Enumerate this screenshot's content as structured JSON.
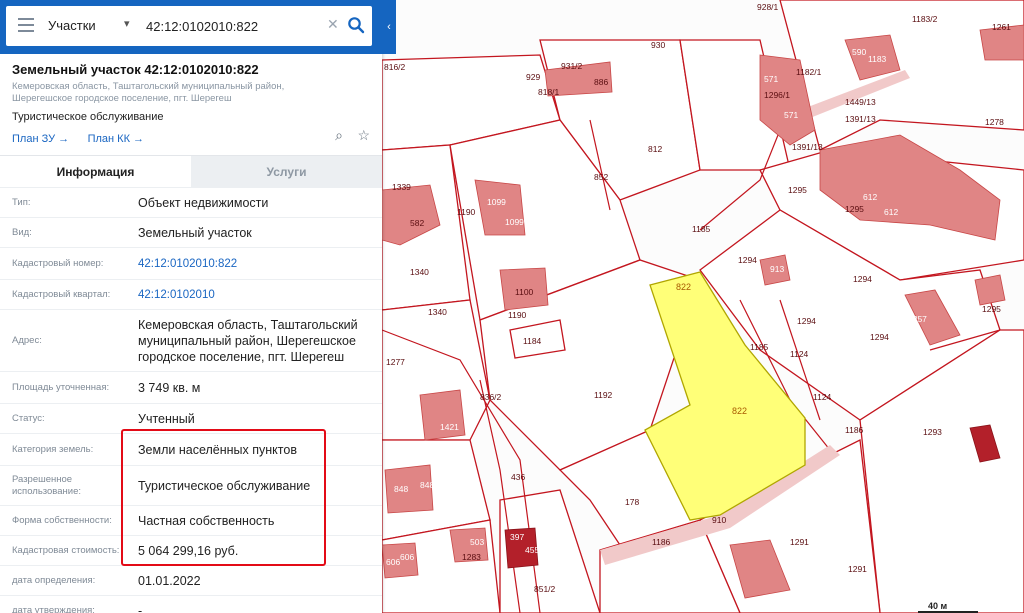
{
  "search": {
    "mode": "Участки",
    "query": "42:12:0102010:822"
  },
  "object": {
    "title": "Земельный участок 42:12:0102010:822",
    "address_short": "Кемеровская область, Таштагольский муниципальный район, Шерегешское городское поселение, пгт. Шерегеш",
    "purpose": "Туристическое обслуживание",
    "links": [
      "План ЗУ →",
      "План КК →"
    ]
  },
  "tabs": {
    "info": "Информация",
    "services": "Услуги"
  },
  "properties": [
    {
      "label": "Тип:",
      "value": "Объект недвижимости"
    },
    {
      "label": "Вид:",
      "value": "Земельный участок"
    },
    {
      "label": "Кадастровый номер:",
      "value": "42:12:0102010:822"
    },
    {
      "label": "Кадастровый квартал:",
      "value": "42:12:0102010"
    },
    {
      "label": "Адрес:",
      "value": "Кемеровская область, Таштагольский муниципальный район, Шерегешское городское поселение, пгт. Шерегеш"
    },
    {
      "label": "Площадь уточненная:",
      "value": "3 749 кв. м"
    },
    {
      "label": "Статус:",
      "value": "Учтенный"
    },
    {
      "label": "Категория земель:",
      "value": "Земли населённых пунктов"
    },
    {
      "label": "Разрешенное использование:",
      "value": "Туристическое обслуживание"
    },
    {
      "label": "Форма собственности:",
      "value": "Частная собственность"
    },
    {
      "label": "Кадастровая стоимость:",
      "value": "5 064 299,16 руб."
    },
    {
      "label": "дата определения:",
      "value": "01.01.2022"
    },
    {
      "label": "дата утверждения:",
      "value": "-"
    }
  ],
  "map": {
    "scale": "40 м",
    "labels": [
      "816/2",
      "929",
      "931/2",
      "886",
      "930",
      "928/1",
      "1261",
      "1183/2",
      "590",
      "1183",
      "818/1",
      "571",
      "1296/1",
      "1182/1",
      "848",
      "571",
      "1449/13",
      "1391/13",
      "1278",
      "812",
      "1391/13",
      "852",
      "1295",
      "1339",
      "582",
      "1190",
      "1099",
      "1099",
      "612",
      "1295",
      "612",
      "1185",
      "1294",
      "913",
      "1340",
      "1100",
      "1294",
      "822",
      "1190",
      "1340",
      "1184",
      "1294",
      "1257",
      "1295",
      "1277",
      "1185",
      "1124",
      "1294",
      "1192",
      "822",
      "1124",
      "836/2",
      "1421",
      "1186",
      "1293",
      "848",
      "848",
      "436",
      "178",
      "910",
      "397",
      "455",
      "1186",
      "1291",
      "503",
      "1283",
      "606",
      "606",
      "851/2",
      "1291"
    ],
    "colors": {
      "parcel_stroke": "#c3161f",
      "building": "#e08585",
      "selected": "#ffff78"
    }
  }
}
